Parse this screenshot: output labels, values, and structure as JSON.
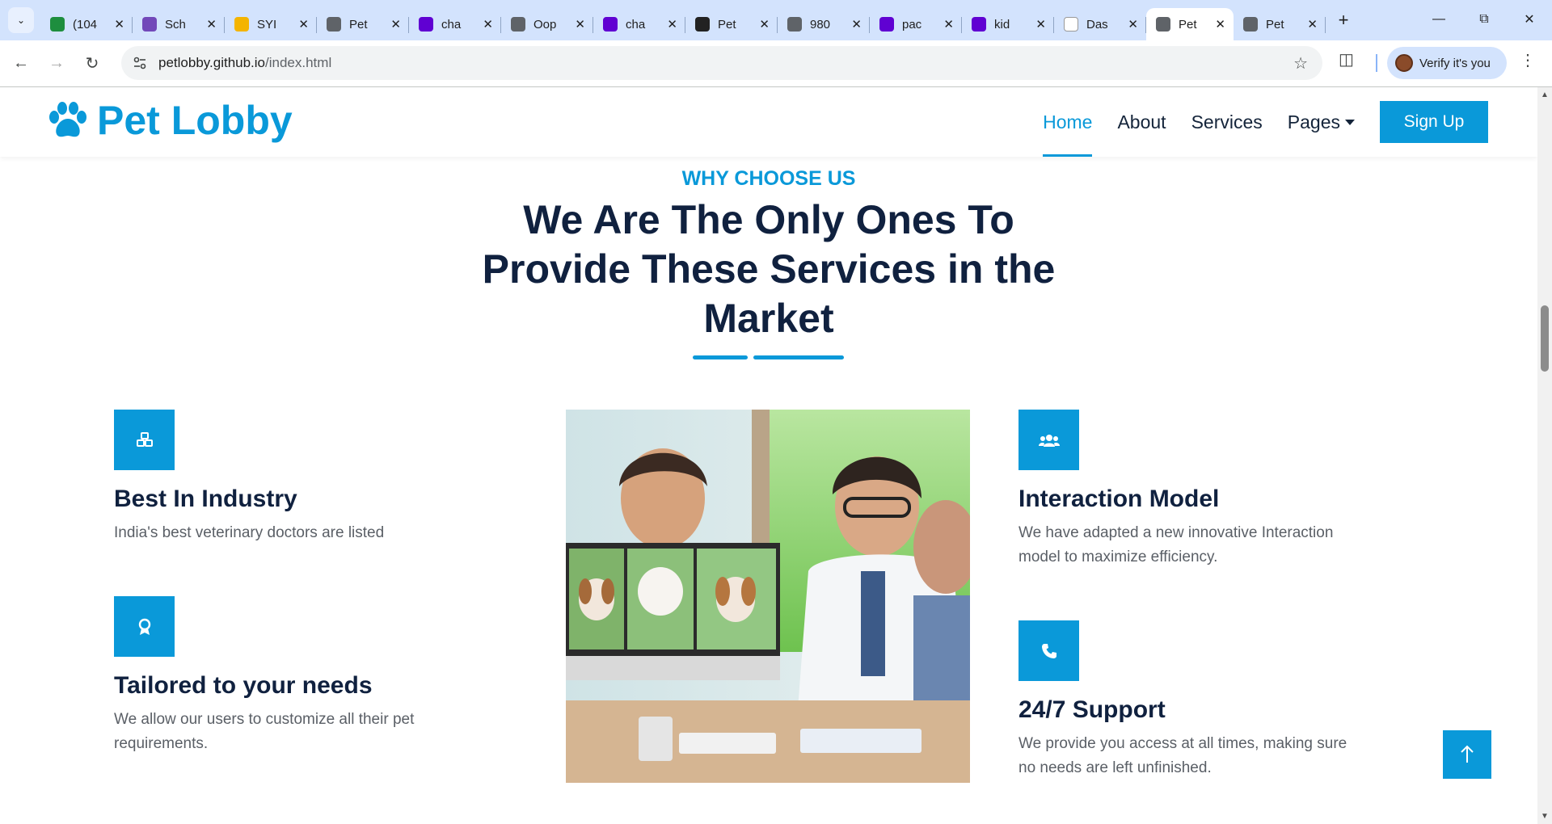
{
  "browser": {
    "tabs": [
      {
        "title": "(104",
        "favicon": "badge-99-icon",
        "color": "#1e8e3e"
      },
      {
        "title": "Sch",
        "favicon": "forms-icon",
        "color": "#7248b9"
      },
      {
        "title": "SYI",
        "favicon": "drive-icon",
        "color": "#f4b400"
      },
      {
        "title": "Pet",
        "favicon": "globe-icon",
        "color": "#5f6368"
      },
      {
        "title": "cha",
        "favicon": "yahoo-icon",
        "color": "#6001d2"
      },
      {
        "title": "Oop",
        "favicon": "ring-icon",
        "color": "#5f6368"
      },
      {
        "title": "cha",
        "favicon": "yahoo-icon",
        "color": "#6001d2"
      },
      {
        "title": "Pet",
        "favicon": "openai-icon",
        "color": "#222222"
      },
      {
        "title": "980",
        "favicon": "globe-icon",
        "color": "#5f6368"
      },
      {
        "title": "pac",
        "favicon": "yahoo-icon",
        "color": "#6001d2"
      },
      {
        "title": "kid",
        "favicon": "yahoo-icon",
        "color": "#6001d2"
      },
      {
        "title": "Das",
        "favicon": "dashboard-icon",
        "color": "#ffffff"
      },
      {
        "title": "Pet",
        "favicon": "globe-icon",
        "color": "#5f6368",
        "active": true
      },
      {
        "title": "Pet",
        "favicon": "globe-icon",
        "color": "#5f6368"
      }
    ],
    "url_host": "petlobby.github.io",
    "url_path": "/index.html",
    "verify_label": "Verify it's you"
  },
  "site": {
    "brand": "Pet Lobby",
    "nav": {
      "home": "Home",
      "about": "About",
      "services": "Services",
      "pages": "Pages",
      "signup": "Sign Up"
    },
    "accent": "#0a99d9",
    "heading_color": "#10213f"
  },
  "section": {
    "eyebrow": "WHY CHOOSE US",
    "headline": "We Are The Only Ones To Provide These Services in the Market",
    "features": [
      {
        "title": "Best In Industry",
        "desc": "India's best veterinary doctors are listed",
        "icon": "cubes-icon"
      },
      {
        "title": "Tailored to your needs",
        "desc": "We allow our users to customize all their pet requirements.",
        "icon": "award-icon"
      },
      {
        "title": "Interaction Model",
        "desc": "We have adapted a new innovative Interaction model to maximize efficiency.",
        "icon": "users-icon"
      },
      {
        "title": "24/7 Support",
        "desc": "We provide you access at all times, making sure no needs are left unfinished.",
        "icon": "phone-icon"
      }
    ],
    "image_alt": "vet-video-call-photo"
  }
}
